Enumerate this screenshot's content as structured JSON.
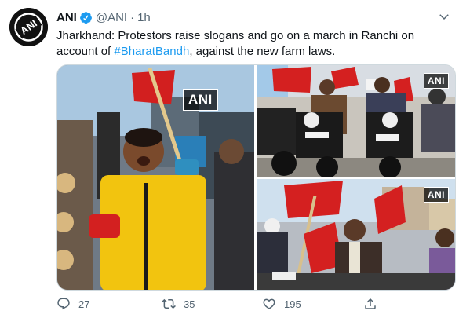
{
  "account": {
    "name": "ANI",
    "handle": "@ANI",
    "separator": "·",
    "time": "1h",
    "avatar_text": "ANI"
  },
  "tweet": {
    "text_before": "Jharkhand: Protestors raise slogans and go on a march in Ranchi on account of ",
    "hashtag": "#BharatBandh",
    "text_after": ", against the new farm laws."
  },
  "media": {
    "watermark": "ANI"
  },
  "actions": {
    "reply_count": "27",
    "retweet_count": "35",
    "like_count": "195"
  },
  "colors": {
    "link": "#1d9bf0",
    "secondary_text": "#536471",
    "verified": "#1d9bf0"
  },
  "icons": {
    "verified": "verified-badge-icon",
    "menu": "chevron-down-icon",
    "reply": "reply-icon",
    "retweet": "retweet-icon",
    "like": "heart-icon",
    "share": "share-icon"
  }
}
